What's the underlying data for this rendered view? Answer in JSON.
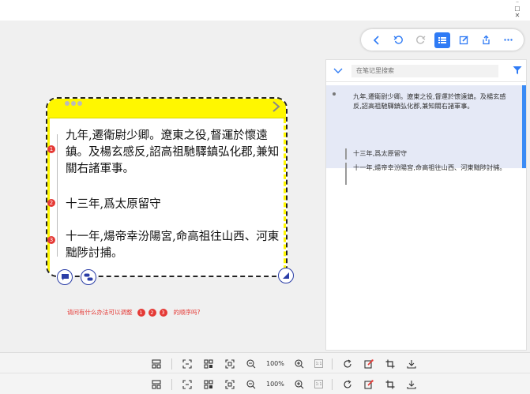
{
  "window": {
    "controls": [
      "⁻",
      "☐",
      "✕"
    ]
  },
  "toolbar": {
    "buttons": [
      "back-icon",
      "undo-icon",
      "redo-icon",
      "list-icon",
      "edit-icon",
      "share-icon",
      "more-icon"
    ]
  },
  "notes": {
    "search_placeholder": "在笔记里搜索",
    "main": "九年,遷衛尉少卿。遼東之役,督運於懷遠鎮。及楊玄感反,詔高祖馳驛鎮弘化郡,兼知關右諸軍事。",
    "sub1": "十三年,爲太原留守",
    "sub2": "十一年,煬帝幸汾陽宮,命高祖往山西、河東黜陟討捕。"
  },
  "card": {
    "paragraphs": [
      "九年,遷衛尉少卿。遼東之役,督運於懷遠鎮。及楊玄感反,詔高祖馳驛鎮弘化郡,兼知關右諸軍事。",
      "十三年,爲太原留守",
      "十一年,煬帝幸汾陽宮,命高祖往山西、河東黜陟討捕。"
    ],
    "markers": [
      "1",
      "2",
      "3"
    ]
  },
  "question": {
    "prefix": "请问有什么办法可以调整",
    "n1": "1",
    "n2": "2",
    "n3": "3",
    "suffix": "的顺序吗?"
  },
  "bottom": {
    "zoom": "100%",
    "fit": "1:1"
  },
  "colors": {
    "accent": "#2f7bf5",
    "highlight": "#fff700",
    "marker": "#e53935"
  }
}
